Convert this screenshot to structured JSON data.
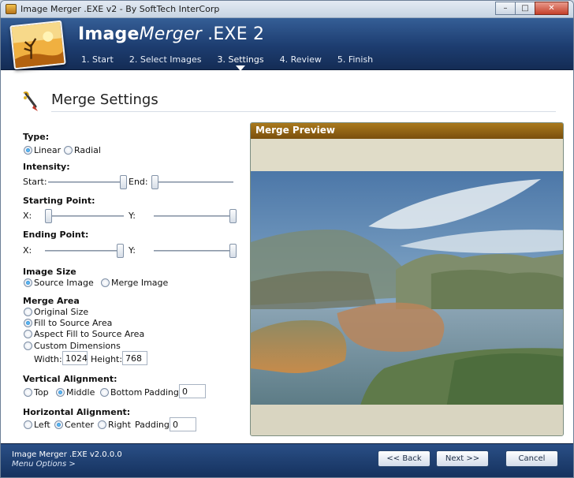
{
  "window": {
    "title": "Image Merger .EXE v2 - By SoftTech InterCorp"
  },
  "brand": {
    "bold": "Image",
    "italic": "Merger",
    "rest": " .EXE 2"
  },
  "steps": [
    {
      "label": "1. Start"
    },
    {
      "label": "2. Select Images"
    },
    {
      "label": "3. Settings",
      "active": true
    },
    {
      "label": "4. Review"
    },
    {
      "label": "5. Finish"
    }
  ],
  "section": {
    "title": "Merge Settings"
  },
  "type": {
    "label": "Type:",
    "options": [
      "Linear",
      "Radial"
    ],
    "selected": "Linear"
  },
  "intensity": {
    "label": "Intensity:",
    "start_label": "Start:",
    "end_label": "End:",
    "start_value": 1.0,
    "end_value": 0.0
  },
  "starting_point": {
    "label": "Starting Point:",
    "x_label": "X:",
    "y_label": "Y:",
    "x_value": 0.0,
    "y_value": 1.0
  },
  "ending_point": {
    "label": "Ending Point:",
    "x_label": "X:",
    "y_label": "Y:",
    "x_value": 1.0,
    "y_value": 1.0
  },
  "image_size": {
    "label": "Image Size",
    "options": [
      "Source Image",
      "Merge Image"
    ],
    "selected": "Source Image"
  },
  "merge_area": {
    "label": "Merge Area",
    "options": [
      "Original Size",
      "Fill to Source Area",
      "Aspect Fill to Source Area",
      "Custom Dimensions"
    ],
    "selected": "Fill to Source Area",
    "width_label": "Width:",
    "width_value": "1024",
    "height_label": "Height:",
    "height_value": "768"
  },
  "vertical_alignment": {
    "label": "Vertical Alignment:",
    "options": [
      "Top",
      "Middle",
      "Bottom"
    ],
    "selected": "Middle",
    "padding_label": "Padding:",
    "padding_value": "0"
  },
  "horizontal_alignment": {
    "label": "Horizontal Alignment:",
    "options": [
      "Left",
      "Center",
      "Right"
    ],
    "selected": "Center",
    "padding_label": "Padding:",
    "padding_value": "0"
  },
  "preview": {
    "title": "Merge Preview"
  },
  "footer": {
    "version": "Image Merger .EXE v2.0.0.0",
    "menu_options": "Menu Options >",
    "back_label": "<< Back",
    "next_label": "Next >>",
    "cancel_label": "Cancel"
  },
  "colors": {
    "header_blue": "#1d3d70",
    "preview_header": "#8f6316",
    "radio_selected": "#1a6fc4"
  },
  "icons": [
    "app-icon",
    "minimize-icon",
    "maximize-icon",
    "close-icon",
    "brush-icon"
  ]
}
